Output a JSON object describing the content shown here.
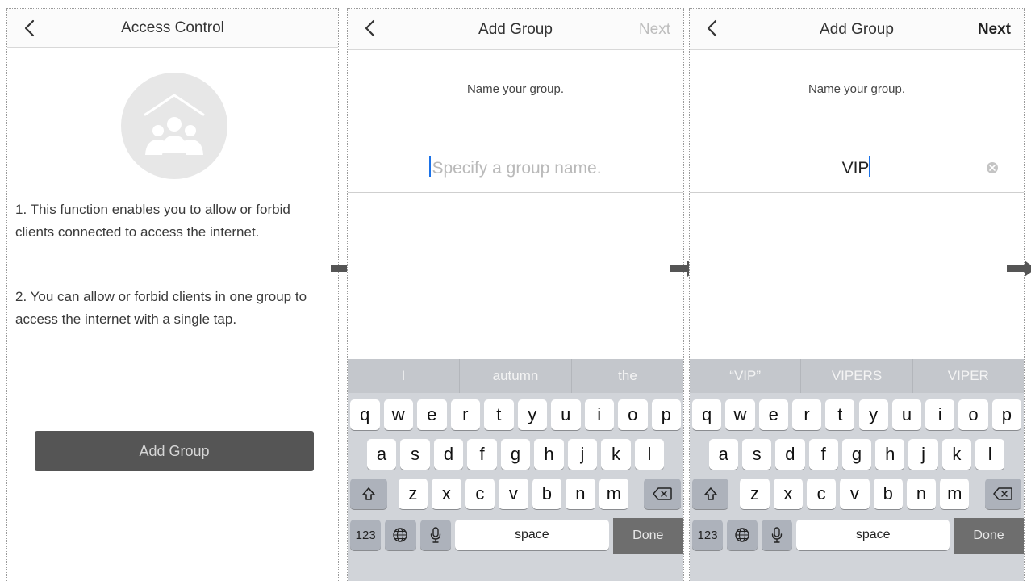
{
  "screen1": {
    "title": "Access Control",
    "paragraph1": "1. This function enables you to allow or forbid clients connected to access the internet.",
    "paragraph2": "2. You can allow or forbid clients in one group to access the internet with a single tap.",
    "add_group_button": "Add Group"
  },
  "screen2": {
    "title": "Add Group",
    "next_label": "Next",
    "prompt": "Name your group.",
    "input_value": "",
    "input_placeholder": "Specify a group name.",
    "suggestions": [
      "I",
      "autumn",
      "the"
    ]
  },
  "screen3": {
    "title": "Add Group",
    "next_label": "Next",
    "prompt": "Name your group.",
    "input_value": "VIP",
    "suggestions": [
      "“VIP”",
      "VIPERS",
      "VIPER"
    ]
  },
  "keyboard": {
    "row1": [
      "q",
      "w",
      "e",
      "r",
      "t",
      "y",
      "u",
      "i",
      "o",
      "p"
    ],
    "row2": [
      "a",
      "s",
      "d",
      "f",
      "g",
      "h",
      "j",
      "k",
      "l"
    ],
    "row3": [
      "z",
      "x",
      "c",
      "v",
      "b",
      "n",
      "m"
    ],
    "numbers_label": "123",
    "space_label": "space",
    "done_label": "Done"
  },
  "icons": {
    "back": "chevron-left-icon",
    "hero": "group-home-icon",
    "clear": "clear-circle-icon",
    "shift": "shift-icon",
    "delete": "backspace-icon",
    "globe": "globe-icon",
    "mic": "microphone-icon",
    "arrow": "right-arrow-icon"
  },
  "colors": {
    "button_bg": "#555555",
    "keyboard_bg": "#d1d4d9",
    "suggestion_bar": "#c4c7cc",
    "special_key": "#adb2bb",
    "done_key": "#6e6e6e",
    "caret": "#1b72e8"
  }
}
